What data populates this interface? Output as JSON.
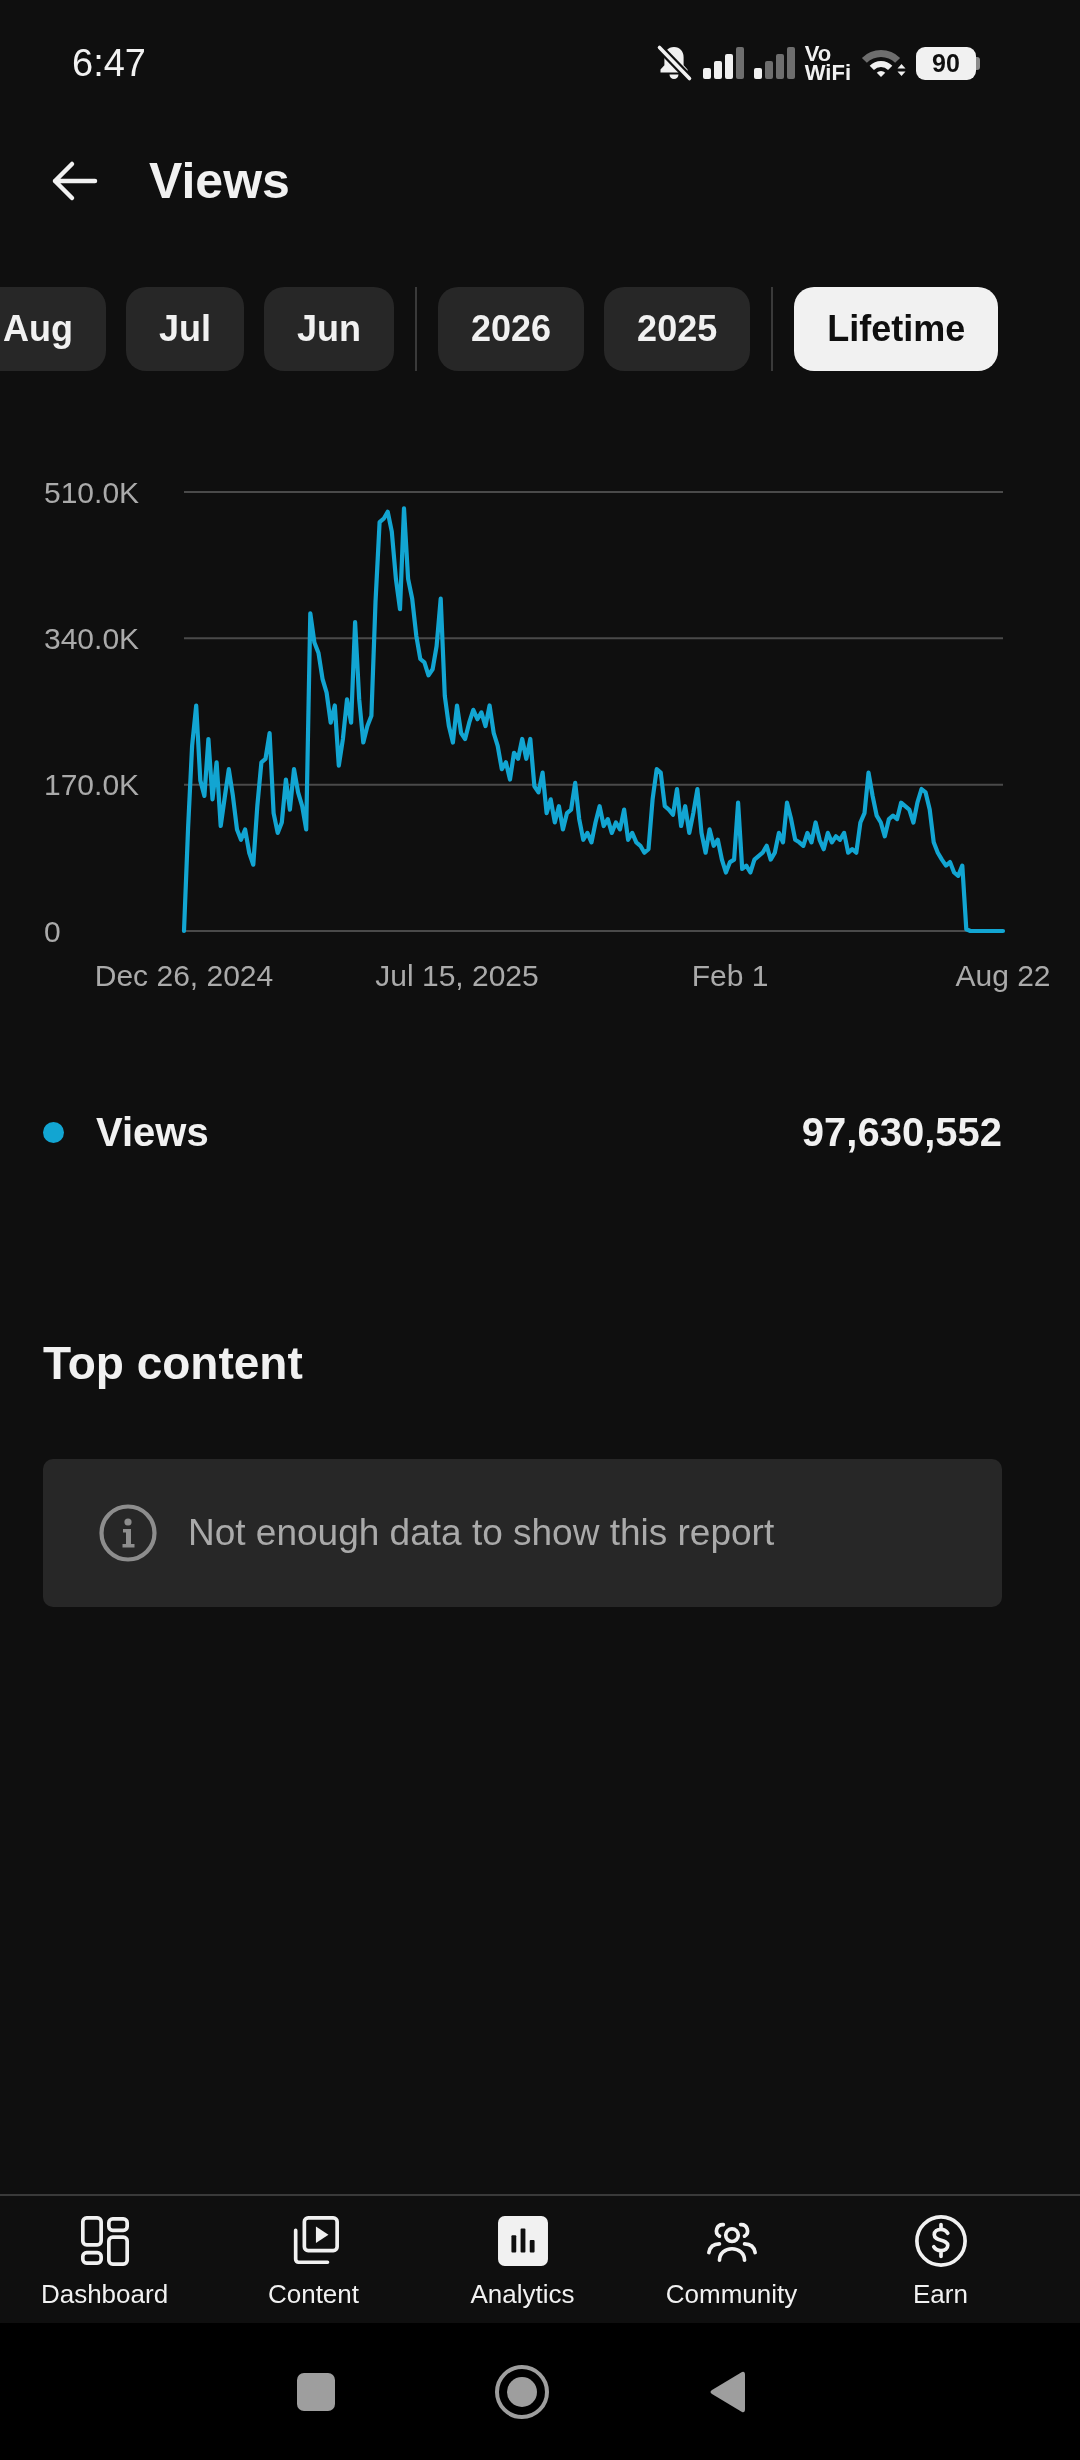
{
  "status_bar": {
    "time": "6:47",
    "network_label": "Vo WiFi",
    "battery": "90"
  },
  "header": {
    "title": "Views"
  },
  "period_groups": [
    {
      "chips": [
        {
          "label": "Aug",
          "selected": false
        },
        {
          "label": "Jul",
          "selected": false
        },
        {
          "label": "Jun",
          "selected": false
        }
      ]
    },
    {
      "chips": [
        {
          "label": "2026",
          "selected": false
        },
        {
          "label": "2025",
          "selected": false
        }
      ]
    },
    {
      "chips": [
        {
          "label": "Lifetime",
          "selected": true
        }
      ]
    }
  ],
  "chart": {
    "chart_data": {
      "type": "line",
      "ylim": [
        0,
        510000
      ],
      "yticks": [
        {
          "value": 0,
          "label": "0"
        },
        {
          "value": 170000,
          "label": "170.0K"
        },
        {
          "value": 340000,
          "label": "340.0K"
        },
        {
          "value": 510000,
          "label": "510.0K"
        }
      ],
      "categories": [
        "Dec 26, 2024",
        null,
        null,
        null,
        null,
        null,
        null,
        null,
        null,
        null,
        null,
        null,
        null,
        null,
        null,
        null,
        null,
        null,
        null,
        null,
        null,
        null,
        null,
        null,
        null,
        null,
        null,
        null,
        null,
        null,
        null,
        null,
        null,
        null,
        null,
        null,
        null,
        null,
        null,
        null,
        null,
        null,
        null,
        null,
        null,
        null,
        null,
        null,
        null,
        null,
        null,
        null,
        null,
        null,
        null,
        null,
        null,
        null,
        null,
        null,
        null,
        null,
        null,
        null,
        null,
        null,
        null,
        "Jul 15, 2025",
        null,
        null,
        null,
        null,
        null,
        null,
        null,
        null,
        null,
        null,
        null,
        null,
        null,
        null,
        null,
        null,
        null,
        null,
        null,
        null,
        null,
        null,
        null,
        null,
        null,
        null,
        null,
        null,
        null,
        null,
        null,
        null,
        null,
        null,
        null,
        null,
        null,
        null,
        null,
        null,
        null,
        null,
        null,
        null,
        null,
        null,
        null,
        null,
        null,
        null,
        null,
        null,
        null,
        null,
        null,
        null,
        null,
        null,
        null,
        null,
        null,
        null,
        null,
        null,
        null,
        null,
        "Feb 1",
        null,
        null,
        null,
        null,
        null,
        null,
        null,
        null,
        null,
        null,
        null,
        null,
        null,
        null,
        null,
        null,
        null,
        null,
        null,
        null,
        null,
        null,
        null,
        null,
        null,
        null,
        null,
        null,
        null,
        null,
        null,
        null,
        null,
        null,
        null,
        null,
        null,
        null,
        null,
        null,
        null,
        null,
        null,
        null,
        null,
        null,
        null,
        null,
        null,
        null,
        null,
        null,
        null,
        null,
        null,
        null,
        null,
        null,
        null,
        null,
        null,
        null,
        null,
        null,
        null,
        null,
        "Aug 22"
      ],
      "series": [
        {
          "name": "Views",
          "color": "#12a5d2",
          "values": [
            0,
            120000,
            215000,
            262000,
            175000,
            157000,
            223000,
            153000,
            196000,
            122000,
            155000,
            188000,
            157000,
            118000,
            106000,
            118000,
            91000,
            77000,
            145000,
            196000,
            200000,
            230000,
            137000,
            114000,
            126000,
            176000,
            141000,
            188000,
            161000,
            145000,
            118000,
            369000,
            335000,
            323000,
            293000,
            277000,
            242000,
            262000,
            192000,
            223000,
            269000,
            242000,
            359000,
            269000,
            219000,
            238000,
            250000,
            382000,
            475000,
            479000,
            487000,
            464000,
            409000,
            374000,
            491000,
            409000,
            386000,
            343000,
            316000,
            312000,
            297000,
            304000,
            331000,
            386000,
            273000,
            238000,
            219000,
            262000,
            230000,
            223000,
            242000,
            257000,
            246000,
            254000,
            238000,
            262000,
            230000,
            215000,
            188000,
            196000,
            176000,
            207000,
            200000,
            223000,
            200000,
            223000,
            168000,
            161000,
            184000,
            137000,
            153000,
            126000,
            145000,
            118000,
            137000,
            141000,
            172000,
            130000,
            106000,
            114000,
            103000,
            126000,
            145000,
            122000,
            130000,
            114000,
            126000,
            118000,
            141000,
            106000,
            114000,
            103000,
            99000,
            91000,
            95000,
            153000,
            188000,
            184000,
            145000,
            141000,
            135000,
            165000,
            122000,
            145000,
            114000,
            137000,
            165000,
            114000,
            91000,
            118000,
            99000,
            106000,
            83000,
            68000,
            80000,
            83000,
            149000,
            72000,
            76000,
            68000,
            83000,
            87000,
            91000,
            99000,
            83000,
            91000,
            114000,
            103000,
            149000,
            130000,
            106000,
            103000,
            99000,
            114000,
            103000,
            126000,
            106000,
            95000,
            114000,
            103000,
            110000,
            106000,
            114000,
            91000,
            95000,
            91000,
            126000,
            137000,
            184000,
            157000,
            134000,
            126000,
            110000,
            130000,
            134000,
            130000,
            149000,
            145000,
            141000,
            126000,
            149000,
            165000,
            161000,
            141000,
            103000,
            91000,
            83000,
            76000,
            80000,
            68000,
            64000,
            76000,
            2000,
            0,
            0,
            0,
            0,
            0,
            0,
            0,
            0,
            0
          ]
        }
      ]
    },
    "total": "97,630,552"
  },
  "top_content": {
    "title": "Top content",
    "empty_message": "Not enough data to show this report"
  },
  "bottom_nav": [
    {
      "kind": "dashboard",
      "label": "Dashboard",
      "selected": false
    },
    {
      "kind": "content",
      "label": "Content",
      "selected": false
    },
    {
      "kind": "analytics",
      "label": "Analytics",
      "selected": true
    },
    {
      "kind": "community",
      "label": "Community",
      "selected": false
    },
    {
      "kind": "earn",
      "label": "Earn",
      "selected": false
    }
  ]
}
